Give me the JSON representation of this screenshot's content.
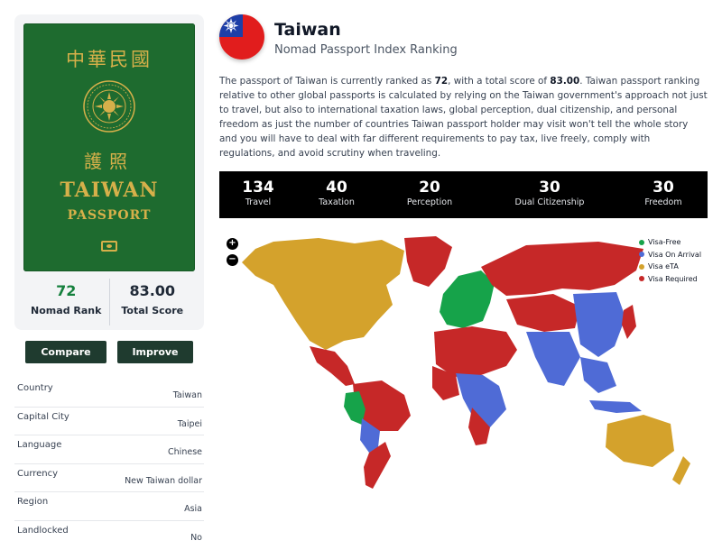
{
  "passport": {
    "chinese_title": "中華民國",
    "chinese_sub": "護照",
    "title": "TAIWAN",
    "subtitle": "PASSPORT"
  },
  "stats": {
    "rank_value": "72",
    "rank_label": "Nomad Rank",
    "score_value": "83.00",
    "score_label": "Total Score"
  },
  "buttons": {
    "compare": "Compare",
    "improve": "Improve"
  },
  "info": [
    {
      "key": "Country",
      "value": "Taiwan"
    },
    {
      "key": "Capital City",
      "value": "Taipei"
    },
    {
      "key": "Language",
      "value": "Chinese"
    },
    {
      "key": "Currency",
      "value": "New Taiwan dollar"
    },
    {
      "key": "Region",
      "value": "Asia"
    },
    {
      "key": "Landlocked",
      "value": "No"
    }
  ],
  "header": {
    "title": "Taiwan",
    "subtitle": "Nomad Passport Index Ranking"
  },
  "description": {
    "p1": "The passport of Taiwan is currently ranked as ",
    "rank": "72",
    "p2": ", with a total score of ",
    "score": "83.00",
    "p3": ". Taiwan passport ranking relative to other global passports is calculated by relying on the Taiwan government's approach not just to travel, but also to international taxation laws, global perception, dual citizenship, and personal freedom as just the number of countries Taiwan passport holder may visit won't tell the whole story and you will have to deal with far different requirements to pay tax, live freely, comply with regulations, and avoid scrutiny when traveling."
  },
  "scores": [
    {
      "value": "134",
      "label": "Travel"
    },
    {
      "value": "40",
      "label": "Taxation"
    },
    {
      "value": "20",
      "label": "Perception"
    },
    {
      "value": "30",
      "label": "Dual Citizenship"
    },
    {
      "value": "30",
      "label": "Freedom"
    }
  ],
  "map": {
    "zoom_in": "+",
    "zoom_out": "−",
    "legend": [
      {
        "label": "Visa-Free",
        "color": "#16a34a"
      },
      {
        "label": "Visa On Arrival",
        "color": "#4f6bd6"
      },
      {
        "label": "Visa eTA",
        "color": "#d4a22c"
      },
      {
        "label": "Visa Required",
        "color": "#c62828"
      }
    ]
  },
  "colors": {
    "passport_green": "#1e6b2f",
    "passport_gold": "#d6b04a",
    "button_bg": "#1f3b2f",
    "rank_green": "#15803d"
  }
}
